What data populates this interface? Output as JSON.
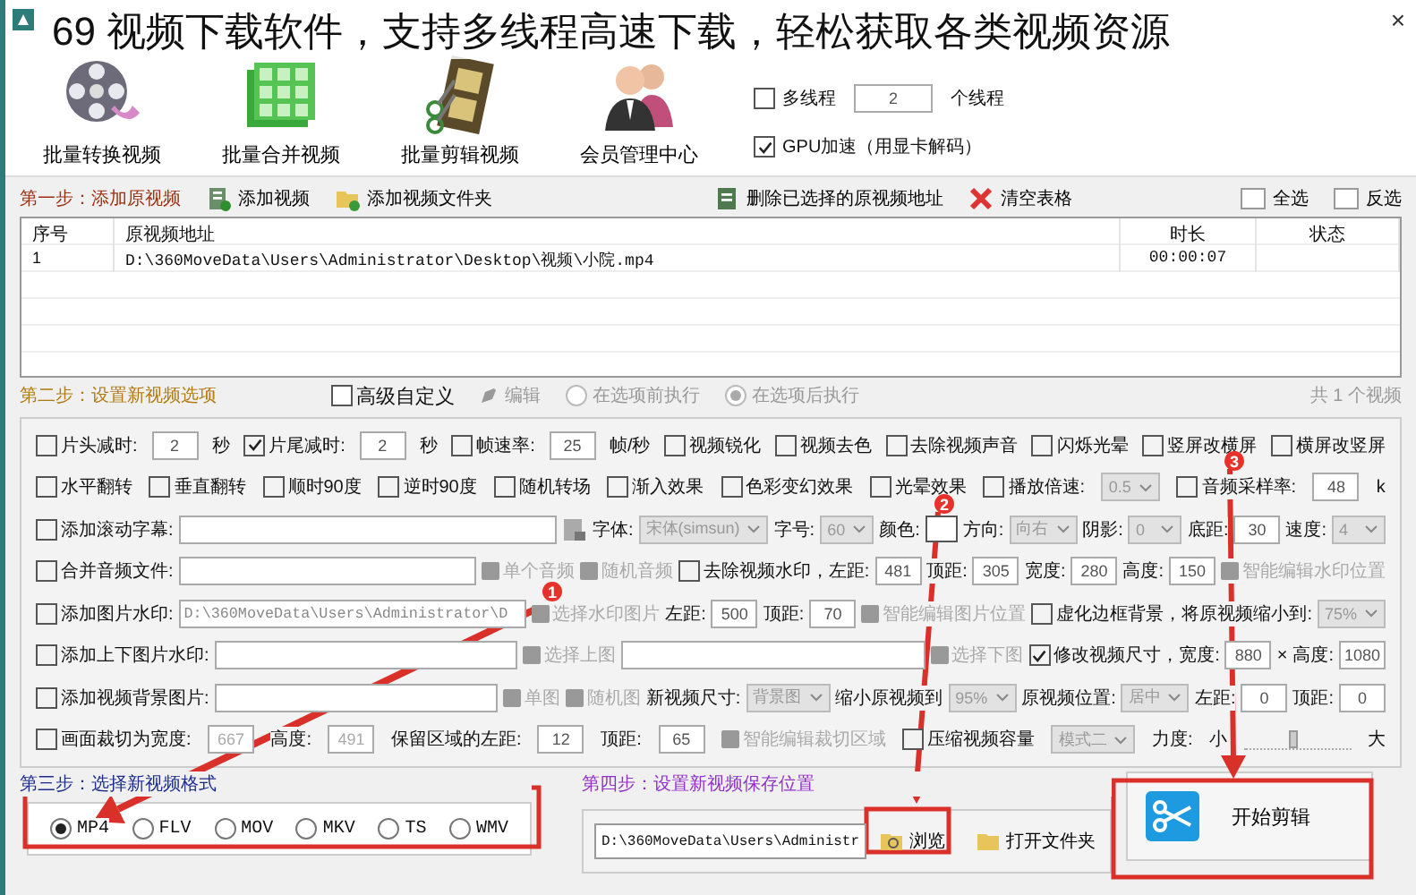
{
  "headline": "69 视频下载软件，支持多线程高速下载，轻松获取各类视频资源",
  "window": {
    "close": "×"
  },
  "tools": [
    {
      "label": "批量转换视频",
      "kind": "reel"
    },
    {
      "label": "批量合并视频",
      "kind": "grid"
    },
    {
      "label": "批量剪辑视频",
      "kind": "strip"
    },
    {
      "label": "会员管理中心",
      "kind": "people"
    }
  ],
  "threads": {
    "multi_label": "多线程",
    "multi_checked": false,
    "count": "2",
    "unit": "个线程",
    "gpu_label": "GPU加速（用显卡解码）",
    "gpu_checked": true
  },
  "step1": {
    "title": "第一步：添加原视频",
    "actions": [
      {
        "label": "添加视频",
        "kind": "add"
      },
      {
        "label": "添加视频文件夹",
        "kind": "folder"
      },
      {
        "label": "删除已选择的原视频地址",
        "kind": "delete"
      },
      {
        "label": "清空表格",
        "kind": "clear"
      }
    ],
    "select_actions": [
      "全选",
      "反选"
    ]
  },
  "table": {
    "columns": [
      "序号",
      "原视频地址",
      "时长",
      "状态"
    ],
    "rows": [
      {
        "index": "1",
        "path": "D:\\360MoveData\\Users\\Administrator\\Desktop\\视频\\小院.mp4",
        "duration": "00:00:07"
      }
    ]
  },
  "step2": {
    "title": "第二步：设置新视频选项",
    "advanced": {
      "label": "高级自定义",
      "checked": false
    },
    "edit": "编辑",
    "run_options": [
      {
        "label": "在选项前执行",
        "selected": false
      },
      {
        "label": "在选项后执行",
        "selected": true
      }
    ],
    "count": "共 1 个视频"
  },
  "options": [
    [
      {
        "kind": "check",
        "label": "片头减时:",
        "checked": false
      },
      {
        "kind": "num",
        "value": "2"
      },
      {
        "kind": "label",
        "text": "秒"
      },
      {
        "kind": "check",
        "label": "片尾减时:",
        "checked": true
      },
      {
        "kind": "num",
        "value": "2"
      },
      {
        "kind": "label",
        "text": "秒"
      },
      {
        "kind": "check",
        "label": "帧速率:",
        "checked": false
      },
      {
        "kind": "num",
        "value": "25"
      },
      {
        "kind": "label",
        "text": "帧/秒"
      },
      {
        "kind": "check",
        "label": "视频锐化",
        "checked": false
      },
      {
        "kind": "check",
        "label": "视频去色",
        "checked": false
      },
      {
        "kind": "check",
        "label": "去除视频声音",
        "checked": false
      },
      {
        "kind": "check",
        "label": "闪烁光晕",
        "checked": false
      },
      {
        "kind": "check",
        "label": "竖屏改横屏",
        "checked": false
      },
      {
        "kind": "check",
        "label": "横屏改竖屏",
        "checked": false
      }
    ],
    [
      {
        "kind": "check",
        "label": "水平翻转",
        "checked": false
      },
      {
        "kind": "check",
        "label": "垂直翻转",
        "checked": false
      },
      {
        "kind": "check",
        "label": "顺时90度",
        "checked": false
      },
      {
        "kind": "check",
        "label": "逆时90度",
        "checked": false
      },
      {
        "kind": "check",
        "label": "随机转场",
        "checked": false
      },
      {
        "kind": "check",
        "label": "渐入效果",
        "checked": false
      },
      {
        "kind": "check",
        "label": "色彩变幻效果",
        "checked": false
      },
      {
        "kind": "check",
        "label": "光晕效果",
        "checked": false
      },
      {
        "kind": "check",
        "label": "播放倍速:",
        "checked": false
      },
      {
        "kind": "select",
        "value": "0.5",
        "disabled": true
      },
      {
        "kind": "check",
        "label": "音频采样率:",
        "checked": false
      },
      {
        "kind": "num",
        "value": "48"
      },
      {
        "kind": "label",
        "text": "k"
      }
    ],
    [
      {
        "kind": "check",
        "label": "添加滚动字幕:",
        "checked": false
      },
      {
        "kind": "text"
      },
      {
        "kind": "font_button"
      },
      {
        "kind": "label",
        "text": "字体:"
      },
      {
        "kind": "select",
        "value": "宋体(simsun)",
        "disabled": true
      },
      {
        "kind": "label",
        "text": "字号:"
      },
      {
        "kind": "select",
        "value": "60",
        "disabled": true
      },
      {
        "kind": "label",
        "text": "颜色:"
      },
      {
        "kind": "swatch"
      },
      {
        "kind": "label",
        "text": "方向:"
      },
      {
        "kind": "select",
        "value": "向右",
        "disabled": true
      },
      {
        "kind": "label",
        "text": "阴影:"
      },
      {
        "kind": "select",
        "value": "0",
        "disabled": true
      },
      {
        "kind": "label",
        "text": "底距:"
      },
      {
        "kind": "num",
        "value": "30"
      },
      {
        "kind": "label",
        "text": "速度:"
      },
      {
        "kind": "select",
        "value": "4",
        "disabled": true
      }
    ],
    [
      {
        "kind": "check",
        "label": "合并音频文件:",
        "checked": false
      },
      {
        "kind": "text"
      },
      {
        "kind": "tool",
        "label": "单个音频",
        "disabled": true
      },
      {
        "kind": "tool",
        "label": "随机音频",
        "disabled": true
      },
      {
        "kind": "check",
        "label": "去除视频水印，左距:",
        "checked": false
      },
      {
        "kind": "num",
        "value": "481"
      },
      {
        "kind": "label",
        "text": "顶距:"
      },
      {
        "kind": "num",
        "value": "305"
      },
      {
        "kind": "label",
        "text": "宽度:"
      },
      {
        "kind": "num",
        "value": "280"
      },
      {
        "kind": "label",
        "text": "高度:"
      },
      {
        "kind": "num",
        "value": "150"
      },
      {
        "kind": "tool",
        "label": "智能编辑水印位置",
        "disabled": true
      }
    ],
    [
      {
        "kind": "check",
        "label": "添加图片水印:",
        "checked": false
      },
      {
        "kind": "text",
        "value": "D:\\360MoveData\\Users\\Administrator\\D"
      },
      {
        "kind": "tool",
        "label": "选择水印图片",
        "disabled": true
      },
      {
        "kind": "label",
        "text": "左距:"
      },
      {
        "kind": "num",
        "value": "500"
      },
      {
        "kind": "label",
        "text": "顶距:"
      },
      {
        "kind": "num",
        "value": "70"
      },
      {
        "kind": "tool",
        "label": "智能编辑图片位置",
        "disabled": true
      },
      {
        "kind": "check",
        "label": "虚化边框背景，将原视频缩小到:",
        "checked": false
      },
      {
        "kind": "select",
        "value": "75%",
        "disabled": true
      }
    ],
    [
      {
        "kind": "check",
        "label": "添加上下图片水印:",
        "checked": false
      },
      {
        "kind": "text"
      },
      {
        "kind": "tool",
        "label": "选择上图",
        "disabled": true
      },
      {
        "kind": "text"
      },
      {
        "kind": "tool",
        "label": "选择下图",
        "disabled": true
      },
      {
        "kind": "check",
        "label": "修改视频尺寸，宽度:",
        "checked": true
      },
      {
        "kind": "num",
        "value": "880"
      },
      {
        "kind": "label",
        "text": "×"
      },
      {
        "kind": "label",
        "text": "高度:"
      },
      {
        "kind": "num",
        "value": "1080"
      }
    ],
    [
      {
        "kind": "check",
        "label": "添加视频背景图片:",
        "checked": false
      },
      {
        "kind": "text"
      },
      {
        "kind": "tool",
        "label": "单图",
        "disabled": true
      },
      {
        "kind": "tool",
        "label": "随机图",
        "disabled": true
      },
      {
        "kind": "label",
        "text": "新视频尺寸:"
      },
      {
        "kind": "select",
        "value": "背景图",
        "disabled": true
      },
      {
        "kind": "label",
        "text": "缩小原视频到"
      },
      {
        "kind": "select",
        "value": "95%",
        "disabled": true
      },
      {
        "kind": "label",
        "text": "原视频位置:"
      },
      {
        "kind": "select",
        "value": "居中",
        "disabled": true
      },
      {
        "kind": "label",
        "text": "左距:"
      },
      {
        "kind": "num",
        "value": "0"
      },
      {
        "kind": "label",
        "text": "顶距:"
      },
      {
        "kind": "num",
        "value": "0"
      }
    ],
    [
      {
        "kind": "check",
        "label": "画面裁切为宽度:",
        "checked": false
      },
      {
        "kind": "num",
        "value": "667",
        "disabled": true
      },
      {
        "kind": "label",
        "text": "高度:"
      },
      {
        "kind": "num",
        "value": "491",
        "disabled": true
      },
      {
        "kind": "label",
        "text": "保留区域的左距:"
      },
      {
        "kind": "num",
        "value": "12"
      },
      {
        "kind": "label",
        "text": "顶距:"
      },
      {
        "kind": "num",
        "value": "65"
      },
      {
        "kind": "tool",
        "label": "智能编辑裁切区域",
        "disabled": true
      },
      {
        "kind": "check",
        "label": "压缩视频容量",
        "checked": false
      },
      {
        "kind": "select",
        "value": "模式二",
        "disabled": true
      },
      {
        "kind": "label",
        "text": "力度:"
      },
      {
        "kind": "label",
        "text": "小"
      },
      {
        "kind": "slider",
        "level": 0.45
      },
      {
        "kind": "label",
        "text": "大"
      }
    ]
  ],
  "step3": {
    "title": "第三步：选择新视频格式",
    "formats": [
      {
        "label": "MP4",
        "selected": true
      },
      {
        "label": "FLV",
        "selected": false
      },
      {
        "label": "MOV",
        "selected": false
      },
      {
        "label": "MKV",
        "selected": false
      },
      {
        "label": "TS",
        "selected": false
      },
      {
        "label": "WMV",
        "selected": false
      }
    ]
  },
  "step4": {
    "title": "第四步：设置新视频保存位置",
    "path": "D:\\360MoveData\\Users\\Administr",
    "browse": "浏览",
    "open_folder": "打开文件夹"
  },
  "start": {
    "label": "开始剪辑"
  },
  "annotations": [
    {
      "number": "1"
    },
    {
      "number": "2"
    },
    {
      "number": "3"
    }
  ]
}
